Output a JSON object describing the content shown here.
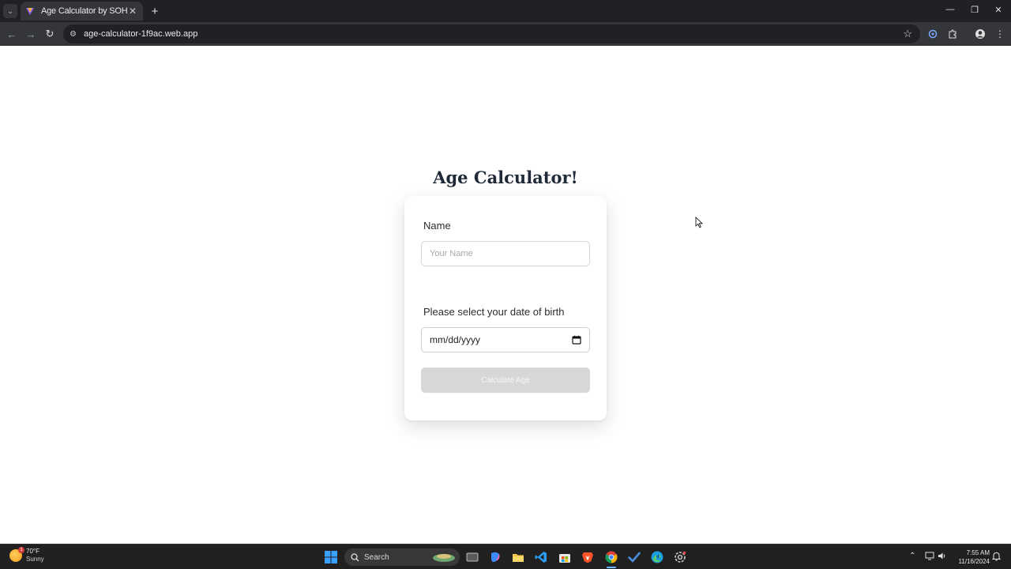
{
  "browser": {
    "tab_title": "Age Calculator by SOHEL RANA",
    "url": "age-calculator-1f9ac.web.app"
  },
  "app": {
    "title": "Age Calculator!",
    "name_label": "Name",
    "name_placeholder": "Your Name",
    "name_value": "",
    "dob_label": "Please select your date of birth",
    "dob_placeholder": "mm/dd/yyyy",
    "button_label": "Calculate Age",
    "button_disabled": true
  },
  "taskbar": {
    "weather_temp": "70°F",
    "weather_condition": "Sunny",
    "weather_badge": "1",
    "search_label": "Search",
    "time": "7:55 AM",
    "date": "11/16/2024"
  },
  "colors": {
    "button_disabled_bg": "#d6d7d9",
    "title_text": "#1f2937",
    "chrome_dark": "#202124",
    "chrome_toolbar": "#35363a"
  }
}
